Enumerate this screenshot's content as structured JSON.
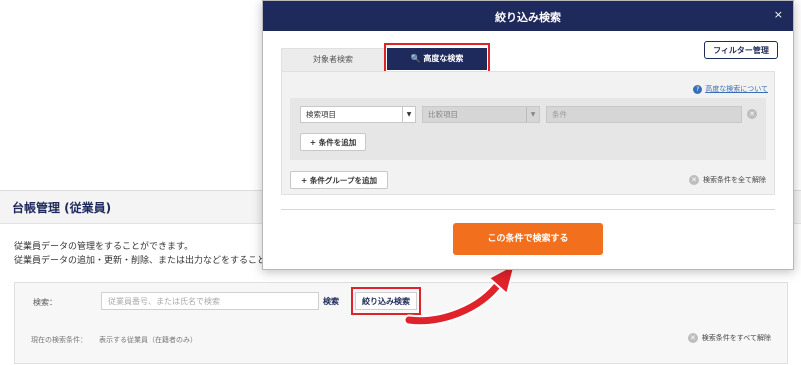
{
  "page": {
    "title": "台帳管理 (従業員)",
    "description_line1": "従業員データの管理をすることができます。",
    "description_line2": "従業員データの追加・更新・削除、または出力などをすることが",
    "search_label": "検索：",
    "search_placeholder": "従業員番号、または氏名で検索",
    "search_button": "検索",
    "narrow_button": "絞り込み検索",
    "current_condition_label": "現在の検索条件：",
    "current_condition_value": "表示する従業員（在籍者のみ）",
    "clear_all_conditions": "検索条件をすべて解除"
  },
  "modal": {
    "title": "絞り込み検索",
    "close": "×",
    "filter_manage": "フィルター管理",
    "tabs": [
      "対象者検索",
      "高度な検索"
    ],
    "help_link": "高度な検索について",
    "search_item": "検索項目",
    "compare_item": "比較項目",
    "condition_placeholder": "条件",
    "add_condition": "条件を追加",
    "add_group": "条件グループを追加",
    "clear_all": "検索条件を全て解除",
    "submit": "この条件で検索する"
  },
  "colors": {
    "navy": "#1d2a5b",
    "highlight": "#e0222b",
    "orange": "#f26f1e"
  }
}
